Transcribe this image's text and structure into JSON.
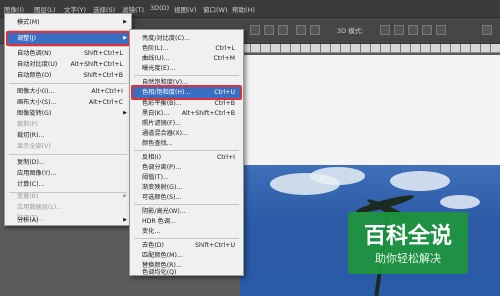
{
  "menubar": {
    "items": [
      "图像(I)",
      "图层(L)",
      "文字(Y)",
      "选择(S)",
      "滤镜(T)",
      "3D(D)",
      "视图(V)",
      "窗口(W)",
      "帮助(H)"
    ]
  },
  "toolbar": {
    "mode_3d": "3D 模式:"
  },
  "image_menu": {
    "items": [
      {
        "label": "模式(M)",
        "shortcut": "",
        "arrow": "▶"
      },
      {
        "label": "调整(J)",
        "shortcut": "",
        "arrow": "▶"
      },
      {
        "label": "自动色调(N)",
        "shortcut": "Shift+Ctrl+L"
      },
      {
        "label": "自动对比度(U)",
        "shortcut": "Alt+Shift+Ctrl+L"
      },
      {
        "label": "自动颜色(O)",
        "shortcut": "Shift+Ctrl+B"
      },
      {
        "label": "图像大小(I)...",
        "shortcut": "Alt+Ctrl+I"
      },
      {
        "label": "画布大小(S)...",
        "shortcut": "Alt+Ctrl+C"
      },
      {
        "label": "图像旋转(G)",
        "shortcut": "",
        "arrow": "▶"
      },
      {
        "label": "裁剪(P)",
        "shortcut": ""
      },
      {
        "label": "裁切(R)...",
        "shortcut": ""
      },
      {
        "label": "显示全部(V)",
        "shortcut": ""
      },
      {
        "label": "复制(D)...",
        "shortcut": ""
      },
      {
        "label": "应用图像(Y)...",
        "shortcut": ""
      },
      {
        "label": "计算(C)...",
        "shortcut": ""
      },
      {
        "label": "变量(B)",
        "shortcut": "",
        "arrow": "▶"
      },
      {
        "label": "应用数据组(L)...",
        "shortcut": ""
      },
      {
        "label": "陷印(T)...",
        "shortcut": ""
      },
      {
        "label": "分析(A)",
        "shortcut": "",
        "arrow": "▶"
      }
    ]
  },
  "adjust_menu": {
    "items": [
      {
        "label": "亮度/对比度(C)...",
        "shortcut": ""
      },
      {
        "label": "色阶(L)...",
        "shortcut": "Ctrl+L"
      },
      {
        "label": "曲线(U)...",
        "shortcut": "Ctrl+M"
      },
      {
        "label": "曝光度(E)...",
        "shortcut": ""
      },
      {
        "label": "自然饱和度(V)...",
        "shortcut": ""
      },
      {
        "label": "色相/饱和度(H)...",
        "shortcut": "Ctrl+U"
      },
      {
        "label": "色彩平衡(B)...",
        "shortcut": "Ctrl+B"
      },
      {
        "label": "黑白(K)...",
        "shortcut": "Alt+Shift+Ctrl+B"
      },
      {
        "label": "照片滤镜(F)...",
        "shortcut": ""
      },
      {
        "label": "通道混合器(X)...",
        "shortcut": ""
      },
      {
        "label": "颜色查找...",
        "shortcut": ""
      },
      {
        "label": "反相(I)",
        "shortcut": "Ctrl+I"
      },
      {
        "label": "色调分离(P)...",
        "shortcut": ""
      },
      {
        "label": "阈值(T)...",
        "shortcut": ""
      },
      {
        "label": "渐变映射(G)...",
        "shortcut": ""
      },
      {
        "label": "可选颜色(S)...",
        "shortcut": ""
      },
      {
        "label": "阴影/高光(W)...",
        "shortcut": ""
      },
      {
        "label": "HDR 色调...",
        "shortcut": ""
      },
      {
        "label": "变化...",
        "shortcut": ""
      },
      {
        "label": "去色(D)",
        "shortcut": "Shift+Ctrl+U"
      },
      {
        "label": "匹配颜色(M)...",
        "shortcut": ""
      },
      {
        "label": "替换颜色(R)...",
        "shortcut": ""
      },
      {
        "label": "色调均化(Q)",
        "shortcut": ""
      }
    ]
  },
  "watermark": {
    "title": "百科全说",
    "subtitle": "助你轻松解决"
  },
  "colors": {
    "highlight": "#3a6ec2",
    "red_outline": "#e0303a",
    "watermark": "#1e963c"
  }
}
